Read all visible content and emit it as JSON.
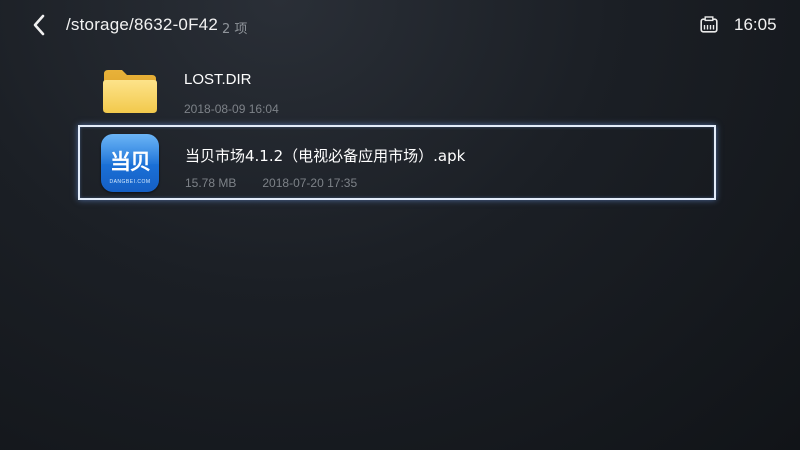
{
  "header": {
    "path": "/storage/8632-0F42",
    "item_count": "2 项",
    "time": "16:05",
    "back_icon": "chevron-left-icon",
    "network_icon": "ethernet-icon"
  },
  "files": [
    {
      "name": "LOST.DIR",
      "kind": "folder",
      "icon": "folder-icon",
      "date": "2018-08-09 16:04"
    },
    {
      "name": "当贝市场4.1.2（电视必备应用市场）.apk",
      "kind": "apk",
      "icon": "dangbei-app-icon",
      "size": "15.78 MB",
      "date": "2018-07-20 17:35",
      "logo_text": "当贝",
      "logo_subtext": "DANGBEI.COM",
      "selected": true
    }
  ],
  "colors": {
    "selection_border": "#e3ecf9",
    "folder_yellow": "#f2c94c",
    "app_blue": "#1a6fd6"
  }
}
